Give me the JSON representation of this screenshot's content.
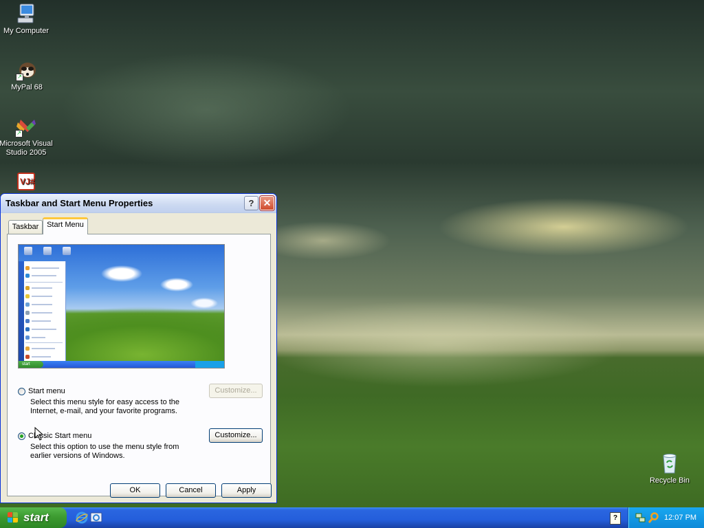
{
  "desktop": {
    "icons": [
      {
        "label": "My Computer",
        "icon": "computer-icon"
      },
      {
        "label": "MyPal 68",
        "icon": "mypal-icon"
      },
      {
        "label": "Microsoft Visual Studio 2005",
        "icon": "visual-studio-icon"
      },
      {
        "label": "",
        "icon": "vj-icon"
      },
      {
        "label": "Recycle Bin",
        "icon": "recycle-bin-icon"
      }
    ]
  },
  "dialog": {
    "title": "Taskbar and Start Menu Properties",
    "help_glyph": "?",
    "close_glyph": "✕",
    "tabs": [
      "Taskbar",
      "Start Menu"
    ],
    "active_tab": "Start Menu",
    "options": [
      {
        "label": "Start menu",
        "description": "Select this menu style for easy access to the Internet, e-mail, and your favorite programs.",
        "selected": false,
        "customize_label": "Customize...",
        "customize_enabled": false
      },
      {
        "label": "Classic Start menu",
        "description": "Select this option to use the menu style from earlier versions of Windows.",
        "selected": true,
        "customize_label": "Customize...",
        "customize_enabled": true
      }
    ],
    "preview": {
      "start_label": "start"
    },
    "buttons": {
      "ok": "OK",
      "cancel": "Cancel",
      "apply": "Apply"
    }
  },
  "taskbar": {
    "start_label": "start",
    "quick_launch": [
      "internet-explorer-icon",
      "show-desktop-icon"
    ],
    "tray_icons": [
      "network-icon",
      "search-icon"
    ],
    "clock": "12:07 PM",
    "help_glyph": "?"
  }
}
